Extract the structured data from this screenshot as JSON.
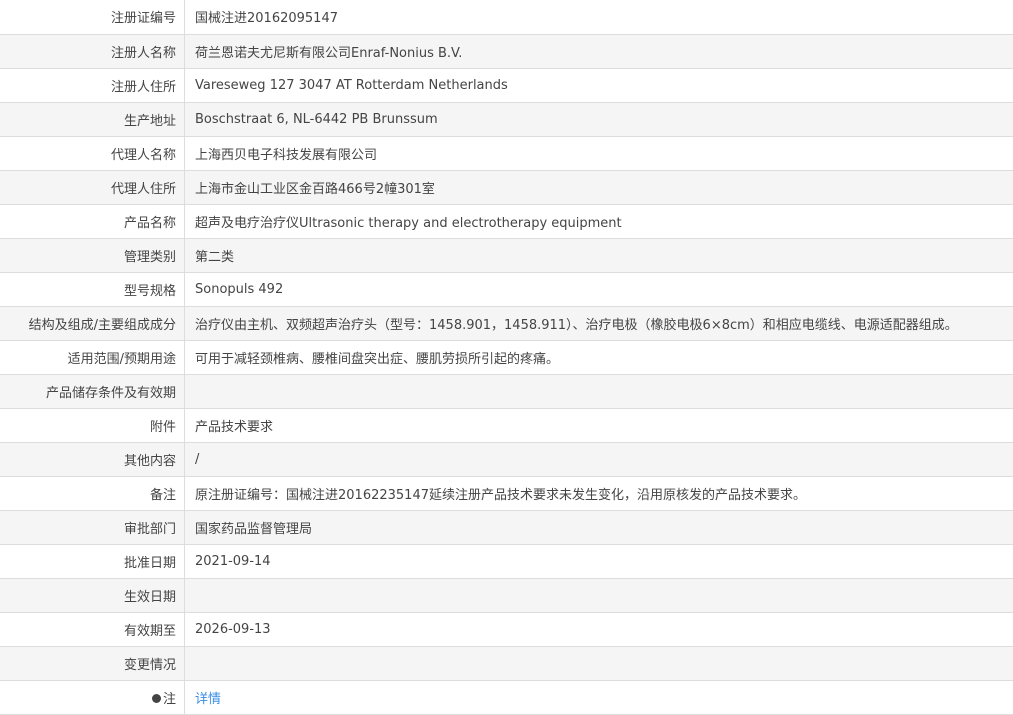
{
  "rows": [
    {
      "label": "注册证编号",
      "value": "国械注进20162095147"
    },
    {
      "label": "注册人名称",
      "value": "荷兰恩诺夫尤尼斯有限公司Enraf-Nonius B.V."
    },
    {
      "label": "注册人住所",
      "value": "Vareseweg 127 3047 AT Rotterdam Netherlands"
    },
    {
      "label": "生产地址",
      "value": "Boschstraat 6, NL-6442 PB Brunssum"
    },
    {
      "label": "代理人名称",
      "value": "上海西贝电子科技发展有限公司"
    },
    {
      "label": "代理人住所",
      "value": "上海市金山工业区金百路466号2幢301室"
    },
    {
      "label": "产品名称",
      "value": "超声及电疗治疗仪Ultrasonic therapy and electrotherapy equipment"
    },
    {
      "label": "管理类别",
      "value": "第二类"
    },
    {
      "label": "型号规格",
      "value": "Sonopuls 492"
    },
    {
      "label": "结构及组成/主要组成成分",
      "value": "治疗仪由主机、双频超声治疗头（型号：1458.901，1458.911）、治疗电极（橡胶电极6×8cm）和相应电缆线、电源适配器组成。"
    },
    {
      "label": "适用范围/预期用途",
      "value": "可用于减轻颈椎病、腰椎间盘突出症、腰肌劳损所引起的疼痛。"
    },
    {
      "label": "产品储存条件及有效期",
      "value": ""
    },
    {
      "label": "附件",
      "value": "产品技术要求"
    },
    {
      "label": "其他内容",
      "value": "/"
    },
    {
      "label": "备注",
      "value": "原注册证编号：国械注进20162235147延续注册产品技术要求未发生变化，沿用原核发的产品技术要求。"
    },
    {
      "label": "审批部门",
      "value": "国家药品监督管理局"
    },
    {
      "label": "批准日期",
      "value": "2021-09-14"
    },
    {
      "label": "生效日期",
      "value": ""
    },
    {
      "label": "有效期至",
      "value": "2026-09-13"
    },
    {
      "label": "变更情况",
      "value": ""
    }
  ],
  "note": {
    "label": "注",
    "link": "详情",
    "icon": "lightbulb-icon"
  }
}
